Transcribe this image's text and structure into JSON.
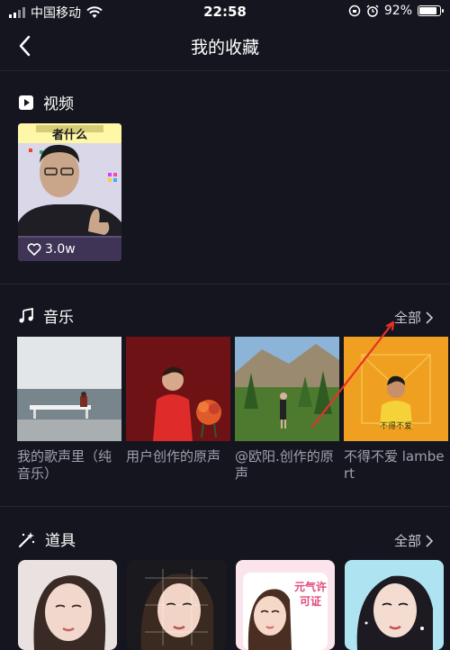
{
  "status_bar": {
    "carrier": "中国移动",
    "time": "22:58",
    "battery": "92%",
    "battery_level": 0.92
  },
  "header": {
    "title": "我的收藏"
  },
  "video_section": {
    "title": "视频",
    "items": [
      {
        "caption": "者什么",
        "likes": "3.0w"
      }
    ]
  },
  "music_section": {
    "title": "音乐",
    "more_label": "全部",
    "items": [
      {
        "title": "我的歌声里（纯音乐）"
      },
      {
        "title": "用户创作的原声"
      },
      {
        "title": "@欧阳.创作的原声"
      },
      {
        "title": "不得不爱 lambert",
        "cover_text": "不得不爱"
      }
    ]
  },
  "props_section": {
    "title": "道具",
    "more_label": "全部",
    "items": [
      {
        "label": ""
      },
      {
        "label": ""
      },
      {
        "label": "元气许可证"
      },
      {
        "label": ""
      }
    ]
  },
  "colors": {
    "background": "#15151f",
    "text_primary": "#ffffff",
    "text_secondary": "#a0a0ac",
    "annotation_arrow": "#e8302a"
  }
}
